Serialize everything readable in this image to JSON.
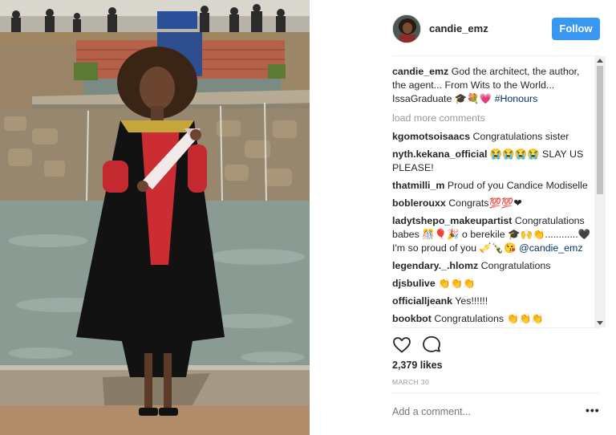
{
  "post": {
    "username": "candie_emz",
    "follow_label": "Follow",
    "caption": {
      "username": "candie_emz",
      "text": " God the architect, the author, the agent... From Wits to the World... IssaGraduate 🎓💐💗 ",
      "hashtag": "#Honours"
    },
    "load_more": "load more comments",
    "comments": [
      {
        "user": "kgomotsoisaacs",
        "text": " Congratulations sister"
      },
      {
        "user": "nyth.kekana_official",
        "text": " 😭😭😭😭 SLAY US PLEASE!"
      },
      {
        "user": "thatmilli_m",
        "text": " Proud of you Candice Modiselle"
      },
      {
        "user": "boblerouxx",
        "text": " Congrats💯💯❤"
      },
      {
        "user": "ladytshepo_makeupartist",
        "text": " Congratulations babes 🎊🎈🎉 o berekile 🎓🙌👏............🖤 I'm so proud of you 🎺🍾😘 ",
        "mention": "@candie_emz"
      },
      {
        "user": "legendary._.hlomz",
        "text": " Congratulations"
      },
      {
        "user": "djsbulive",
        "text": " 👏👏👏"
      },
      {
        "user": "officialljeank",
        "text": " Yes!!!!!!"
      },
      {
        "user": "bookbot",
        "text": " Congratulations 👏👏👏"
      }
    ],
    "likes": "2,379 likes",
    "date": "MARCH 30",
    "add_comment_placeholder": "Add a comment...",
    "more_label": "•••",
    "icons": {
      "like": "heart-icon",
      "comment": "comment-bubble-icon",
      "more": "more-options-icon"
    },
    "colors": {
      "follow_button": "#3897f0",
      "link": "#003569",
      "muted": "#999999"
    }
  }
}
